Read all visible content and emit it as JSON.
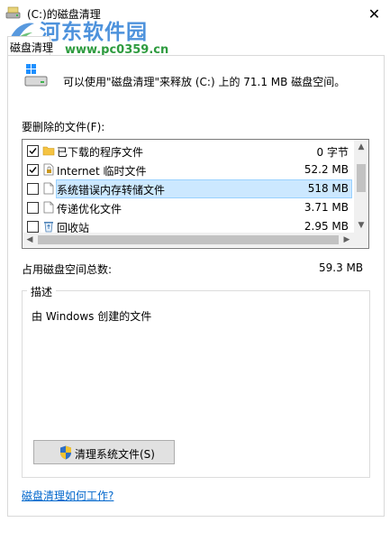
{
  "window": {
    "title": "(C:)的磁盘清理",
    "close_glyph": "✕"
  },
  "watermark": {
    "brand": "河东软件园",
    "url": "www.pc0359.cn"
  },
  "tab": {
    "label": "磁盘清理"
  },
  "intro": {
    "text": "可以使用\"磁盘清理\"来释放  (C:) 上的 71.1 MB 磁盘空间。"
  },
  "files": {
    "label": "要删除的文件(F):",
    "items": [
      {
        "name": "已下载的程序文件",
        "size": "0 字节",
        "checked": true,
        "icon": "folder-icon",
        "selected": false
      },
      {
        "name": "Internet 临时文件",
        "size": "52.2 MB",
        "checked": true,
        "icon": "lock-file-icon",
        "selected": false
      },
      {
        "name": "系统错误内存转储文件",
        "size": "518 MB",
        "checked": false,
        "icon": "file-icon",
        "selected": true
      },
      {
        "name": "传递优化文件",
        "size": "3.71 MB",
        "checked": false,
        "icon": "file-icon",
        "selected": false
      },
      {
        "name": "回收站",
        "size": "2.95 MB",
        "checked": false,
        "icon": "recycle-bin-icon",
        "selected": false
      }
    ]
  },
  "total": {
    "label": "占用磁盘空间总数:",
    "value": "59.3 MB"
  },
  "description": {
    "legend": "描述",
    "text": "由 Windows 创建的文件"
  },
  "cleanup_button": {
    "label": "清理系统文件(S)"
  },
  "help_link": {
    "label": "磁盘清理如何工作?"
  },
  "colors": {
    "selection": "#cce8ff",
    "link": "#0066cc",
    "watermark_blue": "#2e7fd6",
    "watermark_green": "#2e9b3f"
  }
}
